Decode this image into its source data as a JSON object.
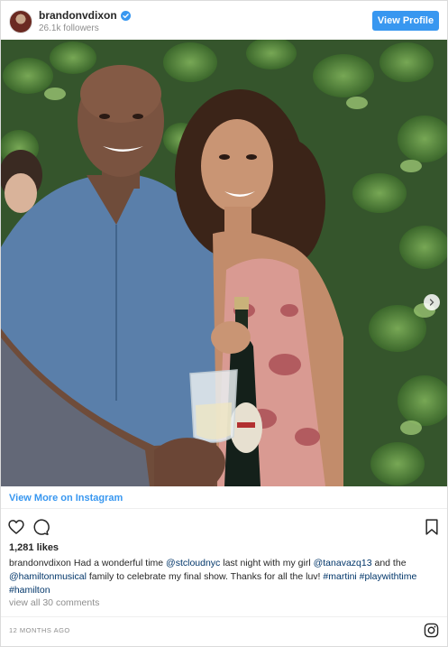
{
  "header": {
    "username": "brandonvdixon",
    "followers": "26.1k followers",
    "view_profile_label": "View Profile"
  },
  "post": {
    "view_more_label": "View More on Instagram",
    "likes": "1,281 likes",
    "caption": {
      "username": "brandonvdixon",
      "parts": [
        {
          "t": "Had a wonderful time ",
          "link": false
        },
        {
          "t": "@stcloudnyc",
          "link": true
        },
        {
          "t": " last night with my girl ",
          "link": false
        },
        {
          "t": "@tanavazq13",
          "link": true
        },
        {
          "t": " and the ",
          "link": false
        },
        {
          "t": "@hamiltonmusical",
          "link": true
        },
        {
          "t": " family to celebrate my final show. Thanks for all the luv! ",
          "link": false
        },
        {
          "t": "#martini",
          "link": true
        },
        {
          "t": " ",
          "link": false
        },
        {
          "t": "#playwithtime",
          "link": true
        },
        {
          "t": " ",
          "link": false
        },
        {
          "t": "#hamilton",
          "link": true
        }
      ]
    },
    "view_comments": "view all 30 comments",
    "timestamp": "12 MONTHS AGO"
  },
  "colors": {
    "accent": "#3897f0",
    "link": "#003569",
    "muted": "#8e8e8e",
    "text": "#262626"
  },
  "icons": [
    "verified-badge-icon",
    "next-arrow-icon",
    "heart-icon",
    "comment-icon",
    "bookmark-icon",
    "instagram-logo-icon"
  ]
}
